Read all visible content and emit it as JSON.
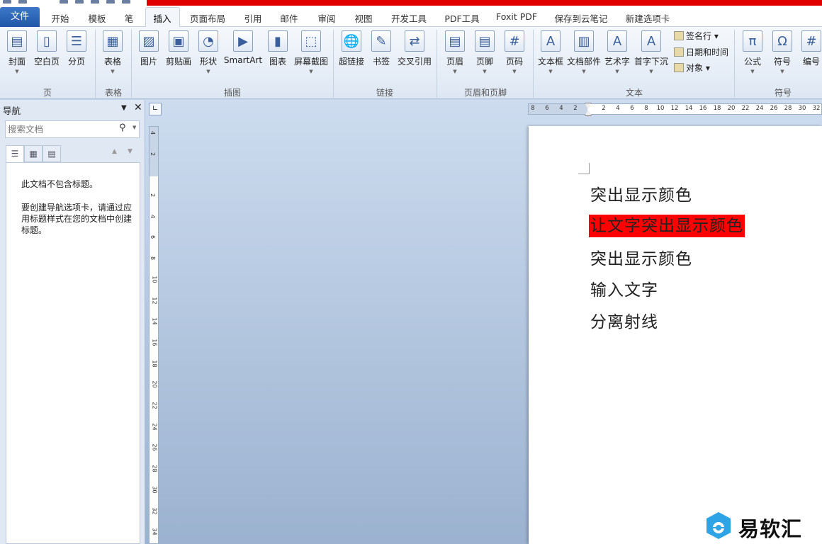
{
  "colors": {
    "highlight": "#ff0000",
    "title_bar": "#e00000",
    "file_tab": "#2a63b4"
  },
  "tabs": [
    {
      "label": "开始"
    },
    {
      "label": "模板"
    },
    {
      "label": "笔"
    },
    {
      "label": "插入"
    },
    {
      "label": "页面布局"
    },
    {
      "label": "引用"
    },
    {
      "label": "邮件"
    },
    {
      "label": "审阅"
    },
    {
      "label": "视图"
    },
    {
      "label": "开发工具"
    },
    {
      "label": "PDF工具"
    },
    {
      "label": "Foxit PDF"
    },
    {
      "label": "保存到云笔记"
    },
    {
      "label": "新建选项卡"
    }
  ],
  "file_tab": "文件",
  "active_tab": "插入",
  "ribbon": {
    "buttons": [
      {
        "label": "封面",
        "icon": "cover-page-icon",
        "dropdown": true
      },
      {
        "label": "空白页",
        "icon": "blank-page-icon",
        "dropdown": false
      },
      {
        "label": "分页",
        "icon": "page-break-icon",
        "dropdown": false
      },
      {
        "label": "表格",
        "icon": "table-icon",
        "dropdown": true
      },
      {
        "label": "图片",
        "icon": "picture-icon",
        "dropdown": false
      },
      {
        "label": "剪贴画",
        "icon": "clip-art-icon",
        "dropdown": false
      },
      {
        "label": "形状",
        "icon": "shapes-icon",
        "dropdown": true
      },
      {
        "label": "SmartArt",
        "icon": "smartart-icon",
        "dropdown": false
      },
      {
        "label": "图表",
        "icon": "chart-icon",
        "dropdown": false
      },
      {
        "label": "屏幕截图",
        "icon": "screenshot-icon",
        "dropdown": true
      },
      {
        "label": "超链接",
        "icon": "hyperlink-icon",
        "dropdown": false
      },
      {
        "label": "书签",
        "icon": "bookmark-icon",
        "dropdown": false
      },
      {
        "label": "交叉引用",
        "icon": "cross-reference-icon",
        "dropdown": false
      },
      {
        "label": "页眉",
        "icon": "header-icon",
        "dropdown": true
      },
      {
        "label": "页脚",
        "icon": "footer-icon",
        "dropdown": true
      },
      {
        "label": "页码",
        "icon": "page-number-icon",
        "dropdown": true
      },
      {
        "label": "文本框",
        "icon": "text-box-icon",
        "dropdown": true
      },
      {
        "label": "文档部件",
        "icon": "quick-parts-icon",
        "dropdown": true
      },
      {
        "label": "艺术字",
        "icon": "wordart-icon",
        "dropdown": true
      },
      {
        "label": "首字下沉",
        "icon": "drop-cap-icon",
        "dropdown": true
      },
      {
        "label": "公式",
        "icon": "equation-icon",
        "dropdown": true
      },
      {
        "label": "符号",
        "icon": "symbol-icon",
        "dropdown": true
      },
      {
        "label": "编号",
        "icon": "number-icon",
        "dropdown": false
      }
    ],
    "small_buttons": [
      {
        "label": "签名行 ▾",
        "icon": "signature-line-icon"
      },
      {
        "label": "日期和时间",
        "icon": "date-time-icon"
      },
      {
        "label": "对象 ▾",
        "icon": "object-icon"
      }
    ],
    "groups": [
      "页",
      "表格",
      "插图",
      "链接",
      "页眉和页脚",
      "文本",
      "符号"
    ]
  },
  "nav": {
    "title": "导航",
    "search_placeholder": "搜索文档",
    "message1": "此文档不包含标题。",
    "message2": "要创建导航选项卡，请通过应用标题样式在您的文档中创建标题。"
  },
  "ruler": {
    "h_ticks": [
      "8",
      "6",
      "4",
      "2",
      "2",
      "4",
      "6",
      "8",
      "10",
      "12",
      "14",
      "16",
      "18",
      "20",
      "22",
      "24",
      "26",
      "28",
      "30",
      "32"
    ],
    "v_ticks": [
      "4",
      "2",
      "2",
      "4",
      "6",
      "8",
      "10",
      "12",
      "14",
      "16",
      "18",
      "20",
      "22",
      "24",
      "26",
      "28",
      "30",
      "32",
      "34"
    ]
  },
  "document": {
    "lines": [
      {
        "text": "突出显示颜色",
        "highlighted": false
      },
      {
        "text": "让文字突出显示颜色",
        "highlighted": true
      },
      {
        "text": "突出显示颜色",
        "highlighted": false
      },
      {
        "text": "输入文字",
        "highlighted": false
      },
      {
        "text": "分离射线",
        "highlighted": false
      }
    ]
  },
  "watermark": "易软汇"
}
